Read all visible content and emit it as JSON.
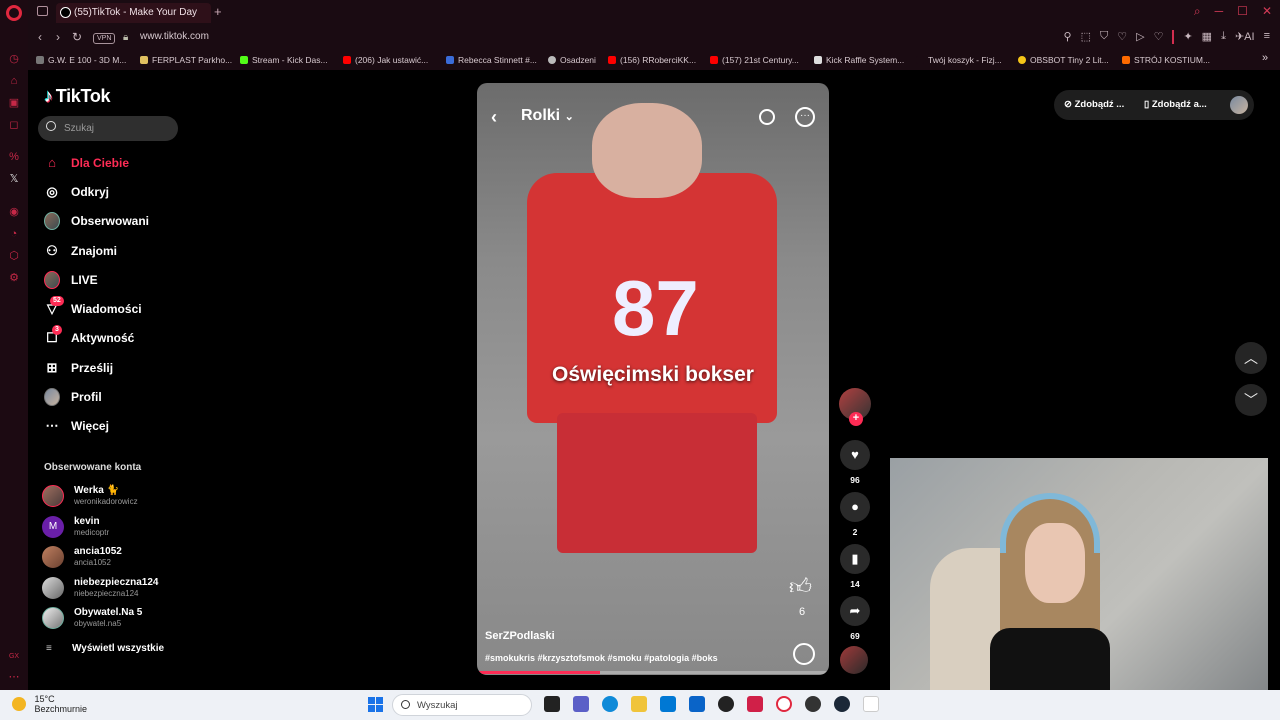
{
  "browser": {
    "tab_title": "(55)TikTok - Make Your Day",
    "tab_add": "+",
    "url": "www.tiktok.com",
    "vpn_label": "VPN",
    "ai_label": "AI",
    "bookmarks": [
      {
        "label": "G.W. E 100 - 3D M...",
        "color": "#777777"
      },
      {
        "label": "FERPLAST Parkho...",
        "color": "#e0c060"
      },
      {
        "label": "Stream - Kick Das...",
        "color": "#53fc18"
      },
      {
        "label": "(206) Jak ustawić...",
        "color": "#ff0000"
      },
      {
        "label": "Rebecca Stinnett #...",
        "color": "#3a6cd8"
      },
      {
        "label": "Osadzeni",
        "color": "#bbbbbb"
      },
      {
        "label": "(156) RRoberciKK...",
        "color": "#ff0000"
      },
      {
        "label": "(157) 21st Century...",
        "color": "#ff0000"
      },
      {
        "label": "Kick Raffle System...",
        "color": "#dddddd"
      },
      {
        "label": "Twój koszyk - Fizj...",
        "color": "#1a0b12"
      },
      {
        "label": "OBSBOT Tiny 2 Lit...",
        "color": "#f5c518"
      },
      {
        "label": "STRÓJ KOSTIUM...",
        "color": "#ff6a00"
      }
    ]
  },
  "tiktok": {
    "logo": "TikTok",
    "search_placeholder": "Szukaj",
    "nav": [
      {
        "label": "Dla Ciebie",
        "icon": "home-icon",
        "active": true
      },
      {
        "label": "Odkryj",
        "icon": "compass-icon"
      },
      {
        "label": "Obserwowani",
        "icon": "avatar-icon"
      },
      {
        "label": "Znajomi",
        "icon": "friends-icon"
      },
      {
        "label": "LIVE",
        "icon": "live-icon"
      },
      {
        "label": "Wiadomości",
        "icon": "send-icon",
        "badge": "52"
      },
      {
        "label": "Aktywność",
        "icon": "activity-icon",
        "badge": "3"
      },
      {
        "label": "Prześlij",
        "icon": "upload-icon"
      },
      {
        "label": "Profil",
        "icon": "profile-icon"
      },
      {
        "label": "Więcej",
        "icon": "more-icon"
      }
    ],
    "following_title": "Obserwowane konta",
    "following": [
      {
        "name": "Werka 🐈",
        "handle": "weronikadorowicz"
      },
      {
        "name": "kevin",
        "handle": "medicoptr",
        "initial": "M"
      },
      {
        "name": "ancia1052",
        "handle": "ancia1052"
      },
      {
        "name": "niebezpieczna124",
        "handle": "niebezpieczna124"
      },
      {
        "name": "Obywatel.Na 5",
        "handle": "obywatel.na5"
      }
    ],
    "show_all": "Wyświetl wszystkie",
    "get_app_1": "Zdobądź ...",
    "get_app_2": "Zdobądź a...",
    "video": {
      "header": "Rolki",
      "jersey_number": "87",
      "caption": "Oświęcimski bokser",
      "like_count_inline": "6",
      "author": "SerZPodlaski",
      "hashtags": "#smokukris #krzysztofsmok #smoku #patologia #boks",
      "progress": 0.35
    },
    "actions": {
      "likes": "96",
      "comments": "2",
      "saves": "14",
      "shares": "69"
    }
  },
  "taskbar": {
    "temperature": "15°C",
    "weather": "Bezchmurnie",
    "search_placeholder": "Wyszukaj"
  }
}
